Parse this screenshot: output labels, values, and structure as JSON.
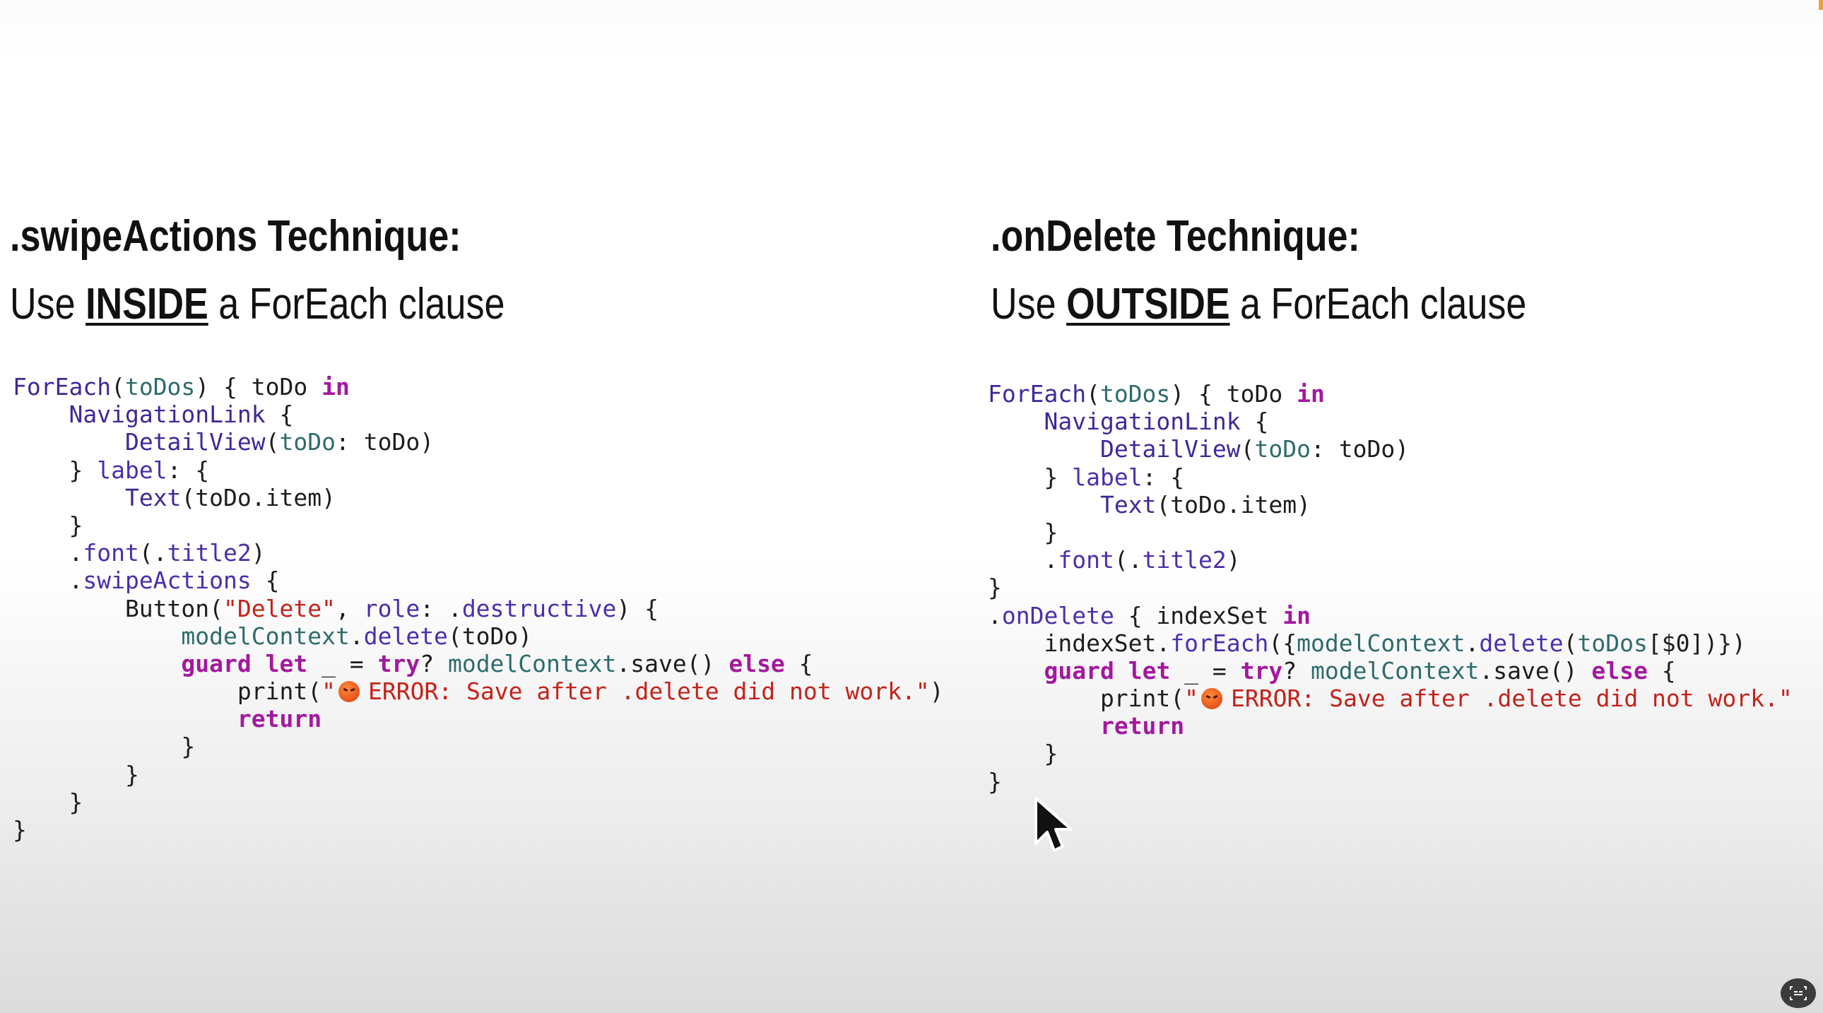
{
  "left": {
    "title": ".swipeActions Technique:",
    "subtitle_pre": "Use ",
    "subtitle_emph": "INSIDE",
    "subtitle_post": " a ForEach clause",
    "code_lines": [
      [
        [
          "ForEach",
          "type"
        ],
        [
          "(",
          "plain"
        ],
        [
          "toDos",
          "var"
        ],
        [
          ") { toDo ",
          "plain"
        ],
        [
          "in",
          "kw"
        ]
      ],
      [
        [
          "    ",
          "plain"
        ],
        [
          "NavigationLink",
          "type"
        ],
        [
          " {",
          "plain"
        ]
      ],
      [
        [
          "        ",
          "plain"
        ],
        [
          "DetailView",
          "type"
        ],
        [
          "(",
          "plain"
        ],
        [
          "toDo",
          "var"
        ],
        [
          ": toDo)",
          "plain"
        ]
      ],
      [
        [
          "    } ",
          "plain"
        ],
        [
          "label",
          "fn"
        ],
        [
          ": {",
          "plain"
        ]
      ],
      [
        [
          "        ",
          "plain"
        ],
        [
          "Text",
          "type"
        ],
        [
          "(toDo.item)",
          "plain"
        ]
      ],
      [
        [
          "    }",
          "plain"
        ]
      ],
      [
        [
          "    .",
          "plain"
        ],
        [
          "font",
          "fn"
        ],
        [
          "(.",
          "plain"
        ],
        [
          "title2",
          "fn"
        ],
        [
          ")",
          "plain"
        ]
      ],
      [
        [
          "    .",
          "plain"
        ],
        [
          "swipeActions",
          "fn"
        ],
        [
          " {",
          "plain"
        ]
      ],
      [
        [
          "        Button(",
          "plain"
        ],
        [
          "\"Delete\"",
          "str"
        ],
        [
          ", ",
          "plain"
        ],
        [
          "role",
          "fn"
        ],
        [
          ": .",
          "plain"
        ],
        [
          "destructive",
          "fn"
        ],
        [
          ") {",
          "plain"
        ]
      ],
      [
        [
          "            ",
          "plain"
        ],
        [
          "modelContext",
          "var"
        ],
        [
          ".",
          "plain"
        ],
        [
          "delete",
          "fn"
        ],
        [
          "(toDo)",
          "plain"
        ]
      ],
      [
        [
          "            ",
          "plain"
        ],
        [
          "guard",
          "kw"
        ],
        [
          " ",
          "plain"
        ],
        [
          "let",
          "kw"
        ],
        [
          " _ = ",
          "plain"
        ],
        [
          "try",
          "kw"
        ],
        [
          "? ",
          "plain"
        ],
        [
          "modelContext",
          "var"
        ],
        [
          ".save() ",
          "plain"
        ],
        [
          "else",
          "kw"
        ],
        [
          " {",
          "plain"
        ]
      ],
      [
        [
          "                print(",
          "plain"
        ],
        [
          "\"",
          "str"
        ],
        [
          "😡",
          "emoji"
        ],
        [
          "ERROR: Save after .delete did not work.\"",
          "str"
        ],
        [
          ")",
          "plain"
        ]
      ],
      [
        [
          "                ",
          "plain"
        ],
        [
          "return",
          "kw"
        ]
      ],
      [
        [
          "            }",
          "plain"
        ]
      ],
      [
        [
          "        }",
          "plain"
        ]
      ],
      [
        [
          "    }",
          "plain"
        ]
      ],
      [
        [
          "}",
          "plain"
        ]
      ]
    ]
  },
  "right": {
    "title": ".onDelete Technique:",
    "subtitle_pre": "Use ",
    "subtitle_emph": "OUTSIDE",
    "subtitle_post": " a ForEach clause",
    "code_lines": [
      [
        [
          "ForEach",
          "type"
        ],
        [
          "(",
          "plain"
        ],
        [
          "toDos",
          "var"
        ],
        [
          ") { toDo ",
          "plain"
        ],
        [
          "in",
          "kw"
        ]
      ],
      [
        [
          "    ",
          "plain"
        ],
        [
          "NavigationLink",
          "type"
        ],
        [
          " {",
          "plain"
        ]
      ],
      [
        [
          "        ",
          "plain"
        ],
        [
          "DetailView",
          "type"
        ],
        [
          "(",
          "plain"
        ],
        [
          "toDo",
          "var"
        ],
        [
          ": toDo)",
          "plain"
        ]
      ],
      [
        [
          "    } ",
          "plain"
        ],
        [
          "label",
          "fn"
        ],
        [
          ": {",
          "plain"
        ]
      ],
      [
        [
          "        ",
          "plain"
        ],
        [
          "Text",
          "type"
        ],
        [
          "(toDo.item)",
          "plain"
        ]
      ],
      [
        [
          "    }",
          "plain"
        ]
      ],
      [
        [
          "    .",
          "plain"
        ],
        [
          "font",
          "fn"
        ],
        [
          "(.",
          "plain"
        ],
        [
          "title2",
          "fn"
        ],
        [
          ")",
          "plain"
        ]
      ],
      [
        [
          "}",
          "plain"
        ]
      ],
      [
        [
          ".",
          "plain"
        ],
        [
          "onDelete",
          "fn"
        ],
        [
          " { indexSet ",
          "plain"
        ],
        [
          "in",
          "kw"
        ]
      ],
      [
        [
          "    indexSet.",
          "plain"
        ],
        [
          "forEach",
          "fn"
        ],
        [
          "({",
          "plain"
        ],
        [
          "modelContext",
          "var"
        ],
        [
          ".",
          "plain"
        ],
        [
          "delete",
          "fn"
        ],
        [
          "(",
          "plain"
        ],
        [
          "toDos",
          "var"
        ],
        [
          "[$0])})",
          "plain"
        ]
      ],
      [
        [
          "    ",
          "plain"
        ],
        [
          "guard",
          "kw"
        ],
        [
          " ",
          "plain"
        ],
        [
          "let",
          "kw"
        ],
        [
          " _ = ",
          "plain"
        ],
        [
          "try",
          "kw"
        ],
        [
          "? ",
          "plain"
        ],
        [
          "modelContext",
          "var"
        ],
        [
          ".save() ",
          "plain"
        ],
        [
          "else",
          "kw"
        ],
        [
          " {",
          "plain"
        ]
      ],
      [
        [
          "        print(",
          "plain"
        ],
        [
          "\"",
          "str"
        ],
        [
          "😡",
          "emoji"
        ],
        [
          "ERROR: Save after .delete did not work.\"",
          "str"
        ]
      ],
      [
        [
          "        ",
          "plain"
        ],
        [
          "return",
          "kw"
        ]
      ],
      [
        [
          "    }",
          "plain"
        ]
      ],
      [
        [
          "}",
          "plain"
        ]
      ]
    ]
  },
  "icons": {
    "cursor": "mouse-pointer-icon",
    "captions": "captions-icon"
  }
}
